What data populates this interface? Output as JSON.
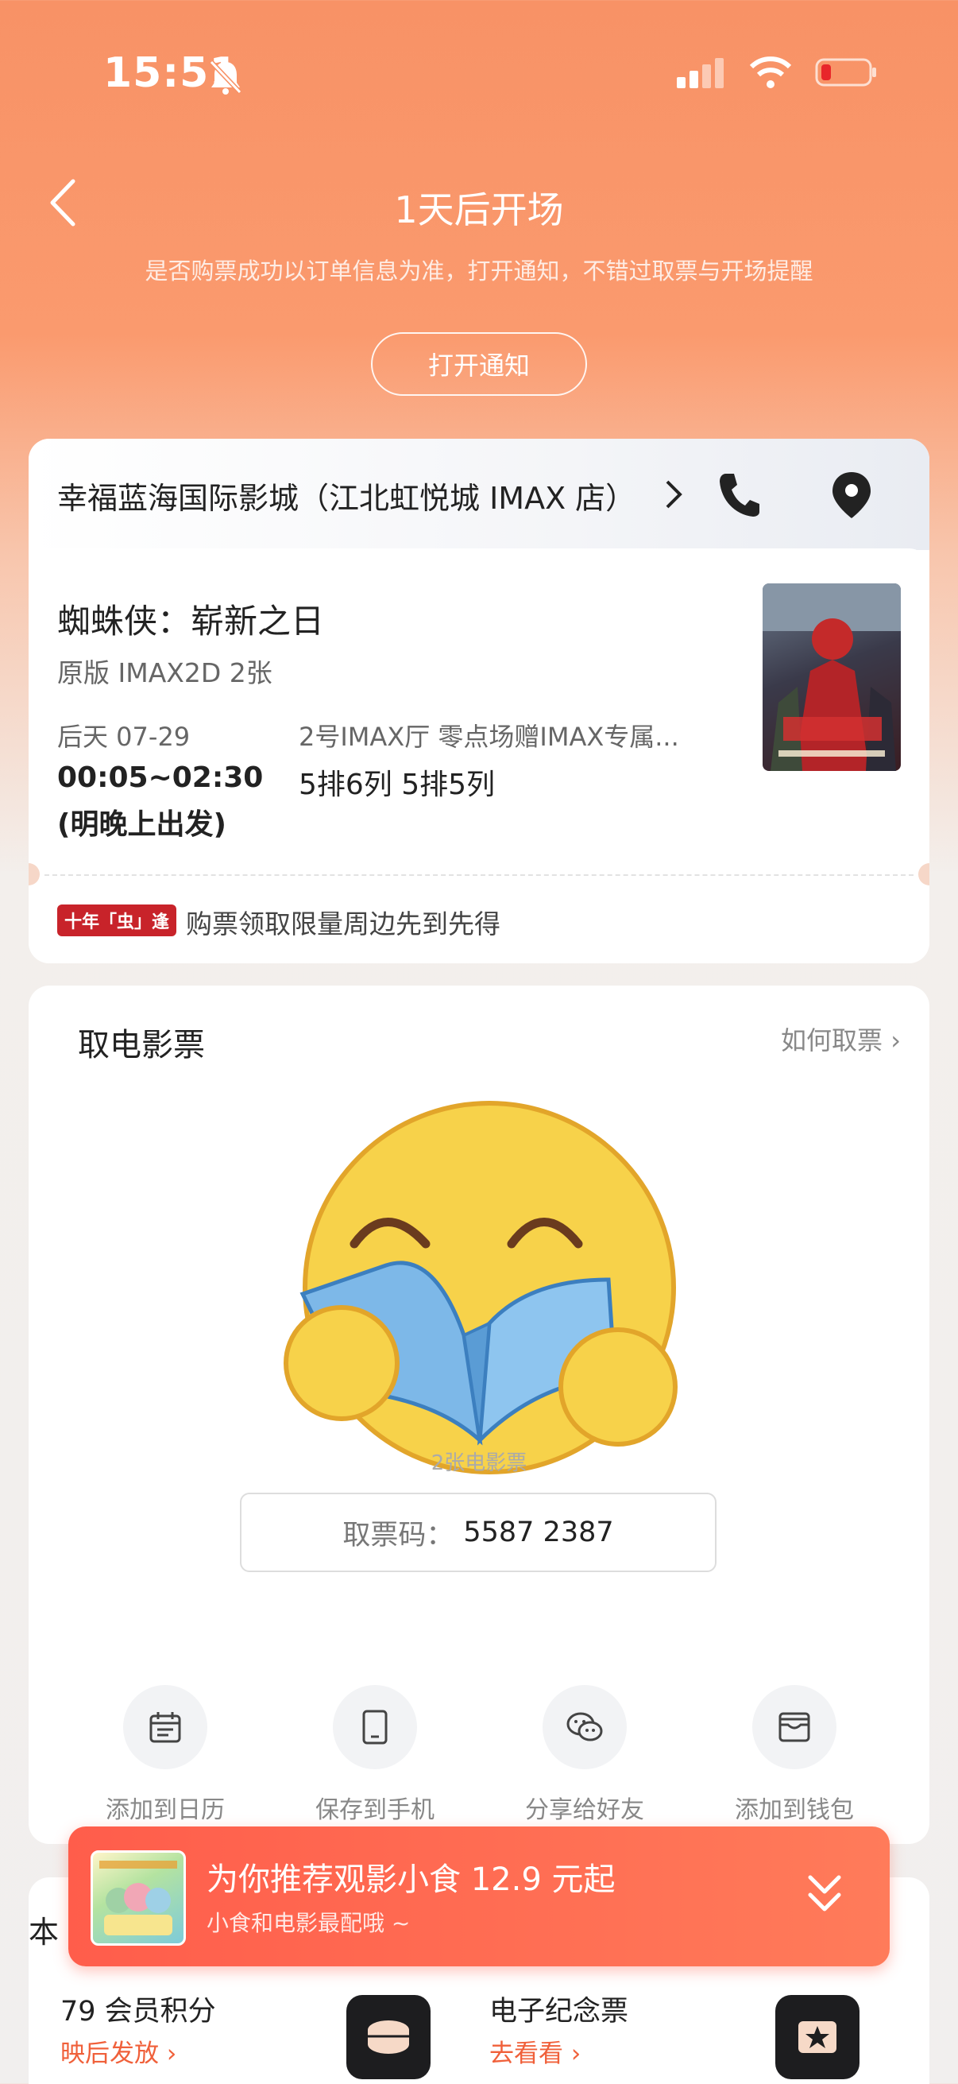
{
  "status_bar": {
    "time": "15:51"
  },
  "header": {
    "title": "1天后开场",
    "subtitle": "是否购票成功以订单信息为准，打开通知，不错过取票与开场提醒",
    "notify_button": "打开通知"
  },
  "cinema": {
    "name": "幸福蓝海国际影城（江北虹悦城 IMAX 店）"
  },
  "movie": {
    "title": "蜘蛛侠：崭新之日",
    "version": "原版 IMAX2D 2张",
    "date": "后天 07-29",
    "time": "00:05~02:30",
    "time_note": "(明晚上出发)",
    "hall": "2号IMAX厅 零点场赠IMAX专属...",
    "seats": "5排6列 5排5列"
  },
  "promo": {
    "badge": "十年「虫」逢",
    "text": "购票领取限量周边先到先得"
  },
  "ticket": {
    "section_title": "取电影票",
    "how_link": "如何取票",
    "qr_caption": "2张电影票",
    "code_label": "取票码：",
    "code_value": "5587 2387"
  },
  "actions": [
    {
      "label": "添加到日历",
      "icon": "calendar-icon"
    },
    {
      "label": "保存到手机",
      "icon": "phone-save-icon"
    },
    {
      "label": "分享给好友",
      "icon": "wechat-icon"
    },
    {
      "label": "添加到钱包",
      "icon": "wallet-icon"
    }
  ],
  "snack_banner": {
    "title": "为你推荐观影小食 12.9 元起",
    "subtitle": "小食和电影最配哦 ~"
  },
  "bottom": {
    "cut_title": "本",
    "cells": [
      {
        "title": "79 会员积分",
        "link": "映后发放"
      },
      {
        "title": "电子纪念票",
        "link": "去看看"
      }
    ]
  },
  "colors": {
    "accent": "#f0603a",
    "banner": "#ff6a50",
    "header": "#f89266"
  }
}
